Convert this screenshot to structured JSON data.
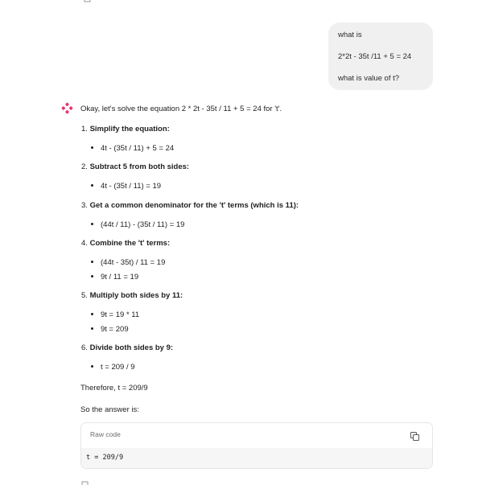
{
  "user_message": {
    "lines": [
      "what is",
      "2*2t - 35t /11 + 5 = 24",
      "what is value of t?"
    ]
  },
  "assistant": {
    "intro": "Okay, let's solve the equation 2 * 2t - 35t / 11 + 5 = 24 for 't'.",
    "steps": [
      {
        "number": "1.",
        "title": "Simplify the equation:",
        "bullets": [
          "4t - (35t / 11) + 5 = 24"
        ]
      },
      {
        "number": "2.",
        "title": "Subtract 5 from both sides:",
        "bullets": [
          "4t - (35t / 11) = 19"
        ]
      },
      {
        "number": "3.",
        "title": "Get a common denominator for the 't' terms (which is 11):",
        "bullets": [
          "(44t / 11) - (35t / 11) = 19"
        ]
      },
      {
        "number": "4.",
        "title": "Combine the 't' terms:",
        "bullets": [
          "(44t - 35t) / 11 = 19",
          "9t / 11 = 19"
        ]
      },
      {
        "number": "5.",
        "title": "Multiply both sides by 11:",
        "bullets": [
          "9t = 19 * 11",
          "9t = 209"
        ]
      },
      {
        "number": "6.",
        "title": "Divide both sides by 9:",
        "bullets": [
          "t = 209 / 9"
        ]
      }
    ],
    "conclusion": "Therefore, t = 209/9",
    "answer_lead": "So the answer is:",
    "code_block": {
      "language_label": "Raw code",
      "code": "t = 209/9",
      "copy_icon": "copy-icon"
    }
  },
  "colors": {
    "bubble_bg": "#f0f0f0",
    "brand_icon": "#e8356d",
    "code_bg": "#f6f6f6"
  }
}
